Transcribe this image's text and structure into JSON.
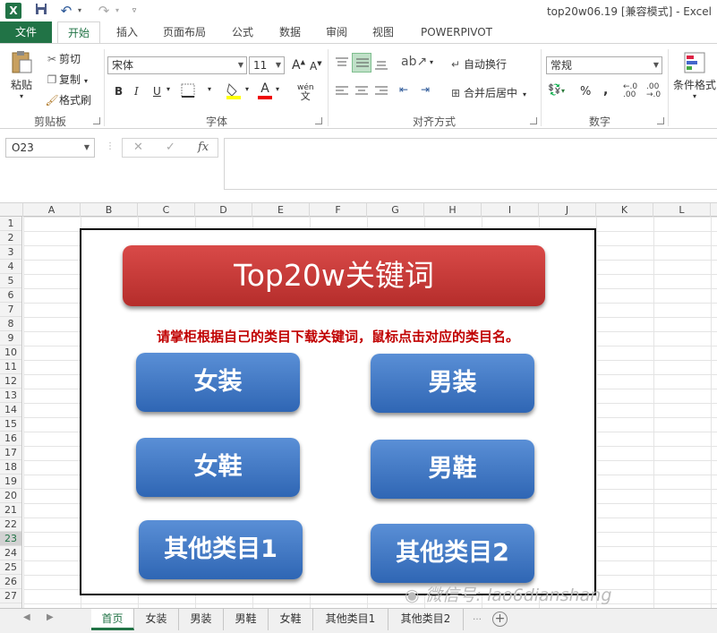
{
  "titlebar": {
    "logo": "X",
    "doc_title": "top20w06.19  [兼容模式] - Excel",
    "qa_icons": [
      "save-icon",
      "undo-icon",
      "redo-icon",
      "customize-icon"
    ]
  },
  "tabs": [
    "文件",
    "开始",
    "插入",
    "页面布局",
    "公式",
    "数据",
    "审阅",
    "视图",
    "POWERPIVOT"
  ],
  "ribbon": {
    "clipboard": {
      "paste": "粘贴",
      "cut": "剪切",
      "copy": "复制",
      "format_painter": "格式刷",
      "label": "剪贴板"
    },
    "font": {
      "name": "宋体",
      "size": "11",
      "bold": "B",
      "italic": "I",
      "underline": "U",
      "grow": "A",
      "shrink": "A",
      "wen": "wén",
      "label": "字体"
    },
    "alignment": {
      "wrap": "自动换行",
      "merge": "合并后居中",
      "label": "对齐方式"
    },
    "number": {
      "format": "常规",
      "percent": "%",
      "comma": ",",
      "label": "数字"
    },
    "styles": {
      "cond_format": "条件格式"
    }
  },
  "formula_bar": {
    "name_box": "O23",
    "cancel": "✕",
    "enter": "✓",
    "fx": "fx",
    "value": ""
  },
  "columns": [
    "A",
    "B",
    "C",
    "D",
    "E",
    "F",
    "G",
    "H",
    "I",
    "J",
    "K",
    "L"
  ],
  "rows": [
    "1",
    "2",
    "3",
    "4",
    "5",
    "6",
    "7",
    "8",
    "9",
    "10",
    "11",
    "12",
    "13",
    "14",
    "15",
    "16",
    "17",
    "18",
    "19",
    "20",
    "21",
    "22",
    "23",
    "24",
    "25",
    "26",
    "27"
  ],
  "panel": {
    "banner": "Top20w关键词",
    "notice": "请掌柜根据自己的类目下载关键词，鼠标点击对应的类目名。",
    "buttons": [
      "女装",
      "男装",
      "女鞋",
      "男鞋",
      "其他类目1",
      "其他类目2"
    ]
  },
  "sheet_tabs": [
    "首页",
    "女装",
    "男装",
    "男鞋",
    "女鞋",
    "其他类目1",
    "其他类目2"
  ],
  "active_sheet": "首页",
  "watermark": "微信号: lao6dianshang",
  "colors": {
    "excel_green": "#217346",
    "banner_red": "#c9393a",
    "button_blue": "#3d74c2",
    "notice_red": "#c00000"
  }
}
